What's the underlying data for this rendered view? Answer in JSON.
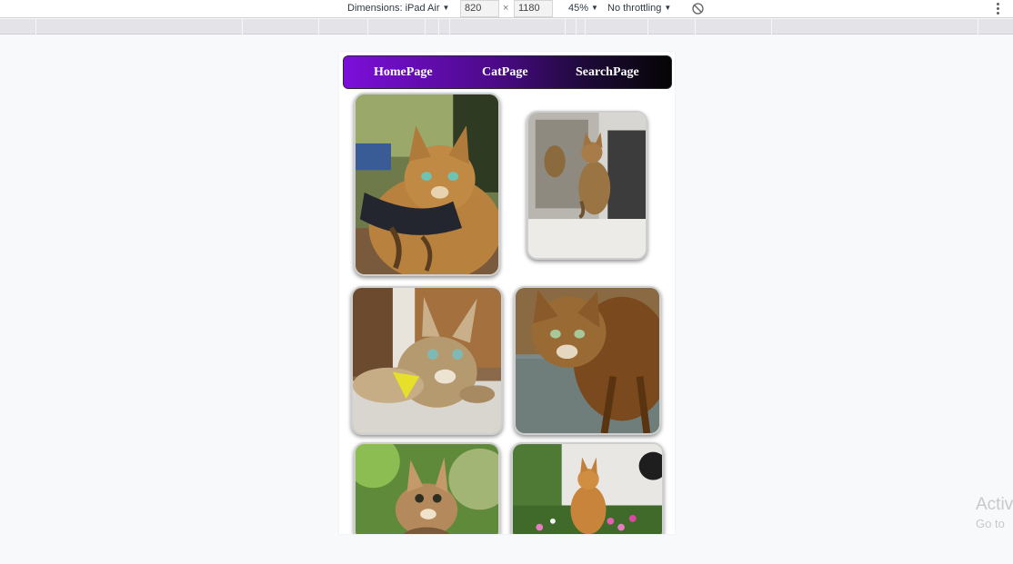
{
  "devtools": {
    "dimensions_label": "Dimensions: iPad Air",
    "width_value": "820",
    "times": "×",
    "height_value": "1180",
    "zoom": "45%",
    "throttling": "No throttling"
  },
  "navbar": {
    "links": [
      {
        "label": "HomePage"
      },
      {
        "label": "CatPage"
      },
      {
        "label": "SearchPage"
      }
    ],
    "gradient_colors": [
      "#7c0fd9",
      "#4d0a8c",
      "#1c0a36",
      "#050505"
    ]
  },
  "gallery": {
    "images": [
      {
        "subject": "bengal cat in harness outdoors"
      },
      {
        "subject": "bengal cat by mirror on window sill"
      },
      {
        "subject": "bengal cat lying on rug with yellow feather toy"
      },
      {
        "subject": "bengal cat standing on patio"
      },
      {
        "subject": "bengal kitten looking up"
      },
      {
        "subject": "bengal cat sitting among flowers"
      }
    ]
  },
  "watermark": {
    "title": "Activ",
    "subtitle": "Go to"
  }
}
